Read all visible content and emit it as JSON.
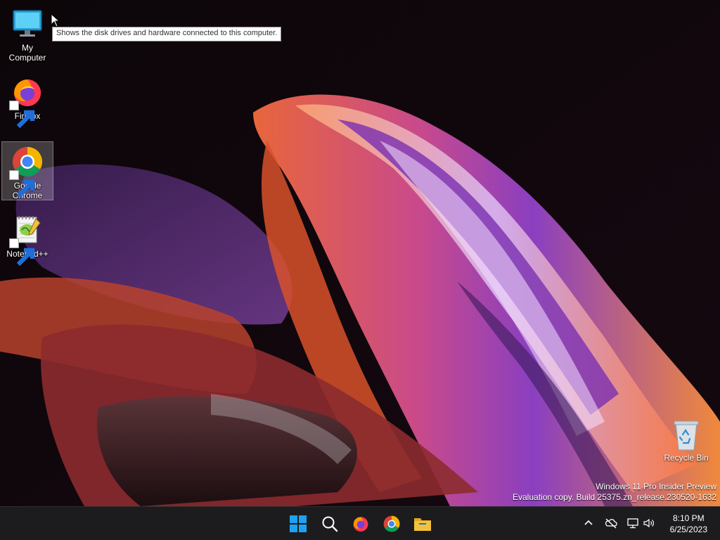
{
  "desktop": {
    "icons": [
      {
        "label": "My Computer",
        "icon": "monitor-icon",
        "selected": false
      },
      {
        "label": "Firefox",
        "icon": "firefox-icon"
      },
      {
        "label": "Google Chrome",
        "icon": "chrome-icon",
        "selected": true
      },
      {
        "label": "Notepad++",
        "icon": "notepadpp-icon"
      }
    ],
    "tooltip": "Shows the disk drives and hardware connected to this computer.",
    "recycle_bin": {
      "label": "Recycle Bin",
      "icon": "recycle-bin-icon"
    },
    "watermark": {
      "line1": "Windows 11 Pro Insider Preview",
      "line2": "Evaluation copy. Build 25375.zn_release.230520-1632"
    }
  },
  "taskbar": {
    "apps": [
      {
        "name": "start",
        "icon": "windows-start-icon"
      },
      {
        "name": "search",
        "icon": "search-icon"
      },
      {
        "name": "firefox",
        "icon": "firefox-icon"
      },
      {
        "name": "chrome",
        "icon": "chrome-icon"
      },
      {
        "name": "file-explorer",
        "icon": "folder-icon"
      }
    ],
    "tray": {
      "icons": [
        "chevron-up-icon",
        "onedrive-offline-icon",
        "network-icon",
        "volume-icon"
      ],
      "time": "8:10 PM",
      "date": "6/25/2023"
    }
  },
  "colors": {
    "taskbar_bg": "#1c1c1e",
    "start_blue": "#1ea1f1",
    "folder_yellow": "#f3c23c"
  }
}
